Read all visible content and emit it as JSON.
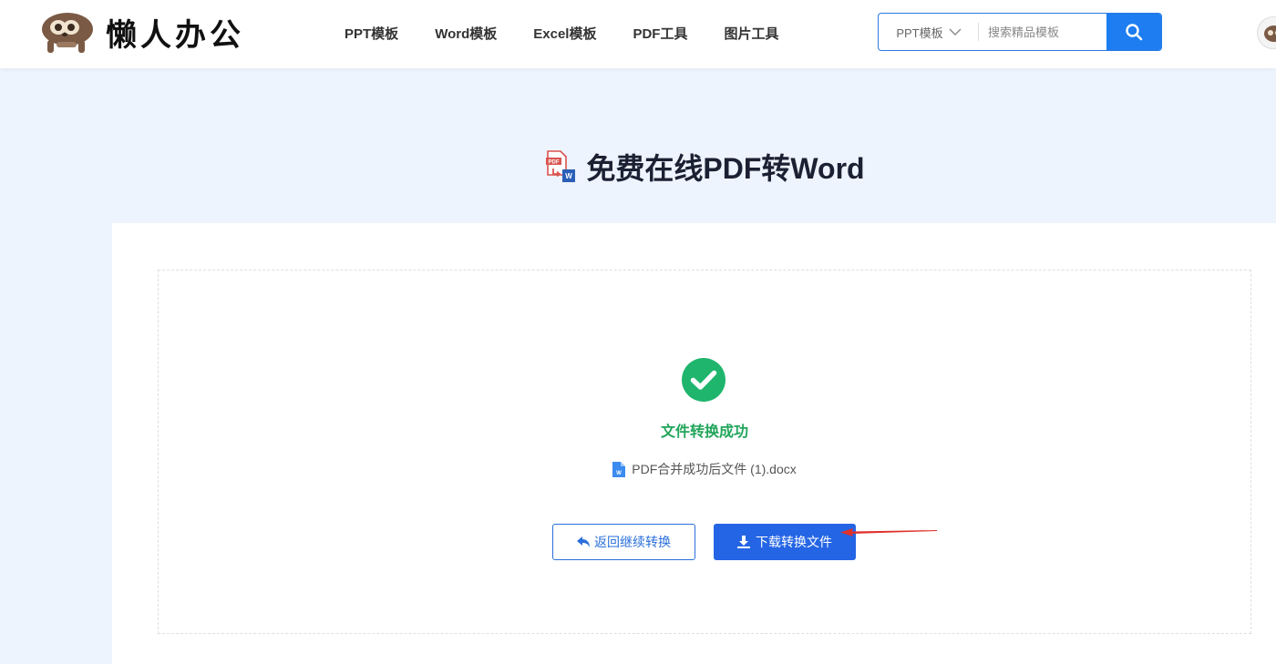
{
  "brand": {
    "name": "懒人办公"
  },
  "nav": {
    "items": [
      {
        "label": "PPT模板"
      },
      {
        "label": "Word模板"
      },
      {
        "label": "Excel模板"
      },
      {
        "label": "PDF工具"
      },
      {
        "label": "图片工具"
      }
    ]
  },
  "search": {
    "category": "PPT模板",
    "placeholder": "搜索精品模板"
  },
  "page": {
    "title": "免费在线PDF转Word"
  },
  "result": {
    "status_text": "文件转换成功",
    "file_name": "PDF合并成功后文件 (1).docx"
  },
  "actions": {
    "back_label": "返回继续转换",
    "download_label": "下载转换文件"
  },
  "colors": {
    "primary": "#2465e5",
    "success": "#21a55b",
    "page_bg": "#eef4fd",
    "annotation_arrow": "#e0312b"
  },
  "icons": {
    "logo": "sloth-logo-icon",
    "search": "search-icon",
    "dropdown": "chevron-down-icon",
    "title": "pdf-to-word-icon",
    "success": "check-circle-icon",
    "file": "word-file-icon",
    "back": "undo-arrow-icon",
    "download": "download-icon"
  }
}
